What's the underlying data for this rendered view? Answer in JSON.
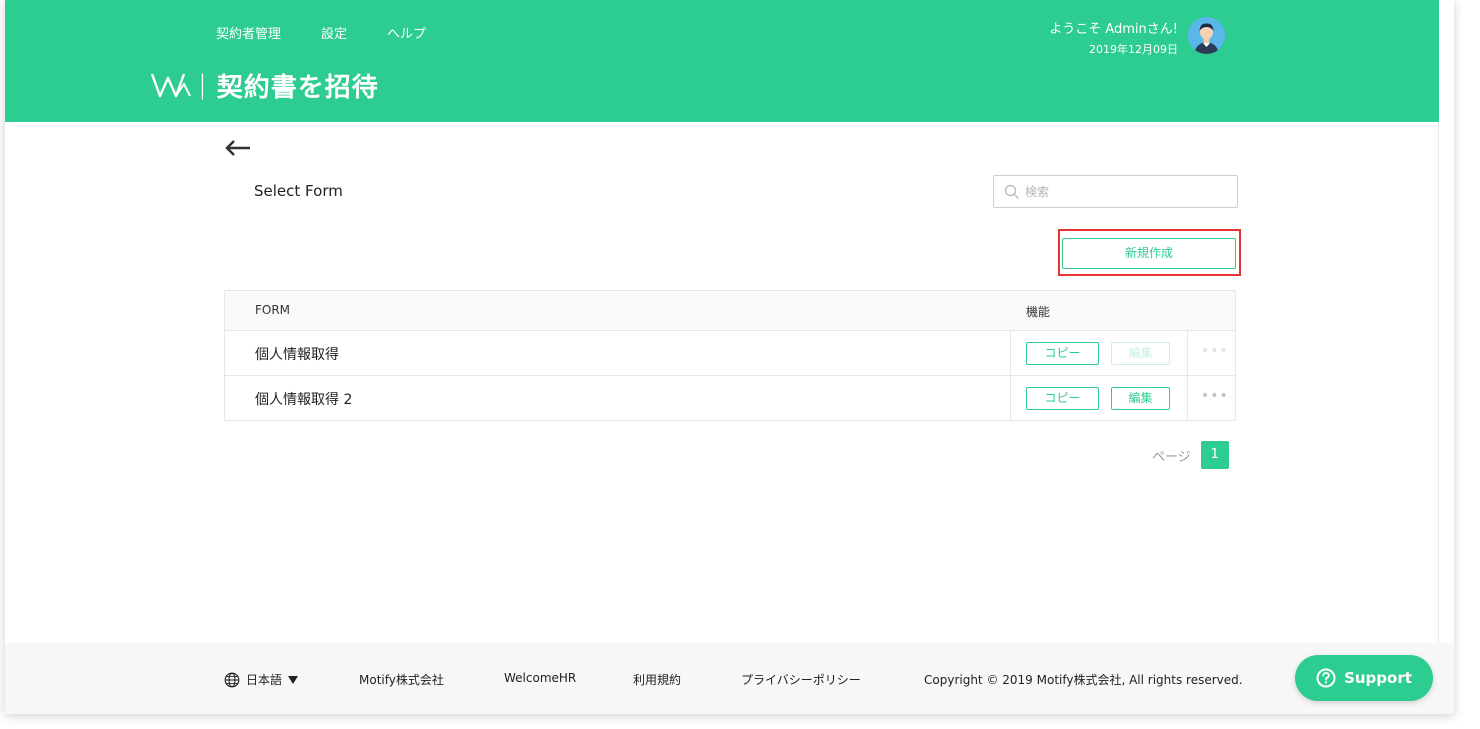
{
  "header": {
    "nav": [
      "契約者管理",
      "設定",
      "ヘルプ"
    ],
    "separator": "|",
    "page_title": "契約書を招待",
    "welcome": "ようこそ Adminさん!",
    "date": "2019年12月09日",
    "brand_color": "#2dcc91"
  },
  "content": {
    "section_title": "Select Form",
    "search_placeholder": "検索",
    "new_button": "新規作成",
    "table": {
      "headers": [
        "FORM",
        "機能"
      ],
      "rows": [
        {
          "name": "個人情報取得",
          "copy": "コピー",
          "edit": "編集",
          "edit_enabled": false,
          "more": "•••"
        },
        {
          "name": "個人情報取得 2",
          "copy": "コピー",
          "edit": "編集",
          "edit_enabled": true,
          "more": "•••"
        }
      ]
    },
    "pager": {
      "label": "ページ",
      "current": "1"
    }
  },
  "footer": {
    "language": "日本語",
    "links": [
      "Motify株式会社",
      "WelcomeHR",
      "利用規約",
      "プライバシーポリシー"
    ],
    "copyright": "Copyright © 2019 Motify株式会社, All rights reserved.",
    "support": "Support"
  }
}
